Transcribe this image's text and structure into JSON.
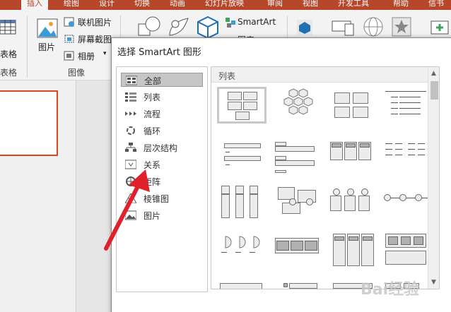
{
  "ribbon": {
    "tabs": [
      "绘图",
      "设计",
      "切换",
      "动画",
      "幻灯片放映",
      "审阅",
      "视图",
      "开发工具",
      "帮助",
      "信书"
    ],
    "active_tab": "插入",
    "table_label": "表格",
    "table_group_label": "表格",
    "picture_label": "图片",
    "online_pictures": "联机图片",
    "screenshot": "屏幕截图",
    "album": "相册",
    "images_group": "图像",
    "smartart": "SmartArt",
    "chart": "图表"
  },
  "dialog": {
    "title": "选择 SmartArt 图形",
    "categories": [
      {
        "label": "全部",
        "icon": "all-icon",
        "selected": true
      },
      {
        "label": "列表",
        "icon": "list-icon"
      },
      {
        "label": "流程",
        "icon": "process-icon"
      },
      {
        "label": "循环",
        "icon": "cycle-icon"
      },
      {
        "label": "层次结构",
        "icon": "hierarchy-icon"
      },
      {
        "label": "关系",
        "icon": "relationship-icon"
      },
      {
        "label": "矩阵",
        "icon": "matrix-icon"
      },
      {
        "label": "棱锥图",
        "icon": "pyramid-icon"
      },
      {
        "label": "图片",
        "icon": "picture-icon"
      }
    ],
    "gallery_title": "列表",
    "right_glyph": "「"
  },
  "watermark": "Bai经验",
  "colors": {
    "accent": "#b7472a",
    "thumb_border": "#d24726",
    "arrow": "#e0202a"
  }
}
